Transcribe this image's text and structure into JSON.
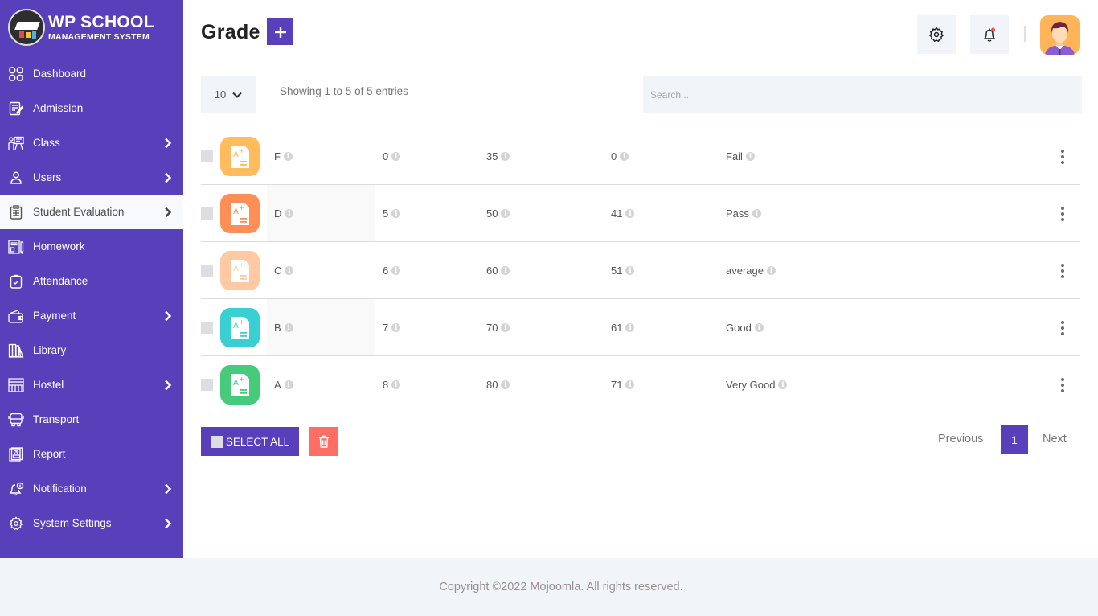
{
  "brand": {
    "title": "WP SCHOOL",
    "subtitle": "MANAGEMENT SYSTEM"
  },
  "sidebar": {
    "items": [
      {
        "label": "Dashboard",
        "icon": "dashboard-grid-icon",
        "has_submenu": false,
        "active": false
      },
      {
        "label": "Admission",
        "icon": "admission-form-icon",
        "has_submenu": false,
        "active": false
      },
      {
        "label": "Class",
        "icon": "classroom-teacher-icon",
        "has_submenu": true,
        "active": false
      },
      {
        "label": "Users",
        "icon": "user-icon",
        "has_submenu": true,
        "active": false
      },
      {
        "label": "Student Evaluation",
        "icon": "clipboard-list-icon",
        "has_submenu": true,
        "active": true
      },
      {
        "label": "Homework",
        "icon": "homework-notebook-icon",
        "has_submenu": false,
        "active": false
      },
      {
        "label": "Attendance",
        "icon": "attendance-check-icon",
        "has_submenu": false,
        "active": false
      },
      {
        "label": "Payment",
        "icon": "wallet-icon",
        "has_submenu": true,
        "active": false
      },
      {
        "label": "Library",
        "icon": "library-books-icon",
        "has_submenu": false,
        "active": false
      },
      {
        "label": "Hostel",
        "icon": "hostel-building-icon",
        "has_submenu": true,
        "active": false
      },
      {
        "label": "Transport",
        "icon": "bus-icon",
        "has_submenu": false,
        "active": false
      },
      {
        "label": "Report",
        "icon": "report-icon",
        "has_submenu": false,
        "active": false
      },
      {
        "label": "Notification",
        "icon": "notification-bell-icon",
        "has_submenu": true,
        "active": false
      },
      {
        "label": "System Settings",
        "icon": "gear-icon",
        "has_submenu": true,
        "active": false
      }
    ]
  },
  "header": {
    "title": "Grade",
    "add_icon": "plus-icon",
    "settings_icon": "gear-icon",
    "notification_icon": "bell-icon",
    "notification_dot_color": "#ff4d4d",
    "avatar_icon": "user-avatar"
  },
  "controls": {
    "page_length": "10",
    "info": "Showing 1 to 5 of 5 entries",
    "search_placeholder": "Search...",
    "search_value": ""
  },
  "table": {
    "rows": [
      {
        "grade": "F",
        "point": "0",
        "max": "35",
        "min": "0",
        "comment": "Fail",
        "icon_color": "#ffbb5c"
      },
      {
        "grade": "D",
        "point": "5",
        "max": "50",
        "min": "41",
        "comment": "Pass",
        "icon_color": "#ff8f54"
      },
      {
        "grade": "C",
        "point": "6",
        "max": "60",
        "min": "51",
        "comment": "average",
        "icon_color": "#ffc9a3"
      },
      {
        "grade": "B",
        "point": "7",
        "max": "70",
        "min": "61",
        "comment": "Good",
        "icon_color": "#39d0d4"
      },
      {
        "grade": "A",
        "point": "8",
        "max": "80",
        "min": "71",
        "comment": "Very Good",
        "icon_color": "#45cb7a"
      }
    ]
  },
  "actions": {
    "select_all": "SELECT ALL",
    "delete_icon": "trash-icon"
  },
  "pagination": {
    "previous": "Previous",
    "current": "1",
    "next": "Next"
  },
  "footer": {
    "copyright": "Copyright ©2022 Mojoomla. All rights reserved."
  },
  "colors": {
    "primary": "#5840bb",
    "danger": "#ff6e65",
    "panel": "#f1f4f9"
  }
}
